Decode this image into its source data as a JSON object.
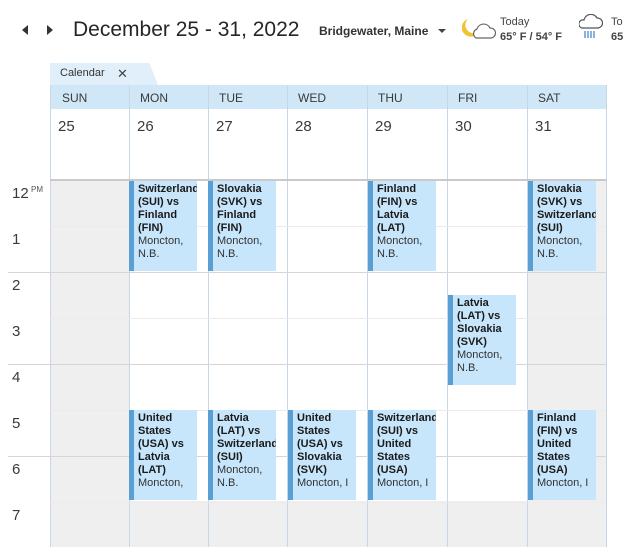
{
  "header": {
    "date_range": "December 25 - 31, 2022",
    "location": "Bridgewater, Maine",
    "weather_today_label": "Today",
    "weather_today_temp": "65° F / 54° F",
    "weather_tomorrow_label": "To",
    "weather_tomorrow_temp": "65"
  },
  "tab": {
    "label": "Calendar",
    "close_symbol": "✕"
  },
  "days": [
    {
      "name": "SUN",
      "date": "25"
    },
    {
      "name": "MON",
      "date": "26"
    },
    {
      "name": "TUE",
      "date": "27"
    },
    {
      "name": "WED",
      "date": "28"
    },
    {
      "name": "THU",
      "date": "29"
    },
    {
      "name": "FRI",
      "date": "30"
    },
    {
      "name": "SAT",
      "date": "31"
    }
  ],
  "time_labels": [
    "12",
    "1",
    "2",
    "3",
    "4",
    "5",
    "6",
    "7"
  ],
  "ampm": "PM",
  "events": [
    {
      "title": "Switzerland\n(SUI) vs\nFinland\n(FIN)",
      "location": "Moncton,\nN.B."
    },
    {
      "title": "Slovakia\n(SVK) vs\nFinland\n(FIN)",
      "location": "Moncton,\nN.B."
    },
    {
      "title": "Finland\n(FIN) vs\nLatvia\n(LAT)",
      "location": "Moncton,\nN.B."
    },
    {
      "title": "Slovakia\n(SVK) vs\nSwitzerland\n(SUI)",
      "location": "Moncton,\nN.B."
    },
    {
      "title": "Latvia\n(LAT) vs\nSlovakia\n(SVK)",
      "location": "Moncton,\nN.B."
    },
    {
      "title": "United\nStates\n(USA) vs\nLatvia\n(LAT)",
      "location": "Moncton,"
    },
    {
      "title": "Latvia\n(LAT) vs\nSwitzerland\n(SUI)",
      "location": "Moncton,\nN.B."
    },
    {
      "title": "United\nStates\n(USA) vs\nSlovakia\n(SVK)",
      "location": "Moncton, I"
    },
    {
      "title": "Switzerland\n(SUI) vs\nUnited\nStates\n(USA)",
      "location": "Moncton, I"
    },
    {
      "title": "Finland\n(FIN) vs\nUnited\nStates\n(USA)",
      "location": "Moncton, I"
    }
  ]
}
